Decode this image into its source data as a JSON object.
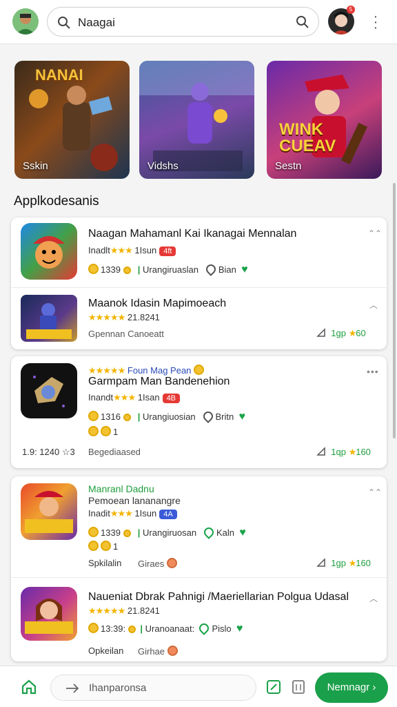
{
  "header": {
    "search_value": "Naagai",
    "notification_count": "5"
  },
  "banners": [
    {
      "title": "NANAI",
      "label": "Sskin"
    },
    {
      "title": "",
      "label": "Vidshs"
    },
    {
      "title": "WINK CUEAV",
      "label": "Sestn"
    }
  ],
  "section_title": "Applkodesanis",
  "cards": [
    {
      "items": [
        {
          "title": "Naagan Mahamanl Kai Ikanagai Mennalan",
          "dev": "Inadlt",
          "stars": "★★★",
          "rating": "1Isun",
          "tag": "4ft",
          "coins": "1339",
          "status": "Urangiruaslan",
          "loc": "Bian"
        },
        {
          "title": "Maanok Idasin Mapimoeach",
          "stars": "★★★★★",
          "rating": "21.8241",
          "meta": "Gpennan Canoeatt",
          "share": "1gp",
          "share_score": "60"
        }
      ]
    },
    {
      "items": [
        {
          "headline": "Foun Mag Pean",
          "stars": "★★★★★",
          "title": "Garmpam Man Bandenehion",
          "dev": "Inandt",
          "stars2": "★★★",
          "rating": "1Isan",
          "tag": "4B",
          "coins": "1316",
          "status": "Urangiuosian",
          "loc": "Britn",
          "extra": "1",
          "footer_left": "1.9: 1240 ☆3",
          "footer_mid": "Begediaased",
          "share": "1qp",
          "share_score": "160"
        }
      ]
    },
    {
      "items": [
        {
          "headline": "Manranl Dadnu",
          "sub": "Pemoean lananangre",
          "dev": "Inadit",
          "stars": "★★★",
          "rating": "1Isun",
          "tag": "4A",
          "coins": "1339",
          "status": "Urangiruosan",
          "loc": "Kaln",
          "extra": "1",
          "footer_left": "Spkilalin",
          "footer_mid": "Giraes",
          "share": "1gp",
          "share_score": "160"
        },
        {
          "title": "Naueniat Dbrak Pahnigi /Maeriellarian Polgua Udasal",
          "stars": "★★★★★",
          "rating": "21.8241",
          "coins": "13:39:",
          "status": "Uranoanaat:",
          "loc": "Pislo",
          "footer_left": "Opkeilan",
          "footer_mid": "Girhae"
        }
      ]
    }
  ],
  "bottom": {
    "input_placeholder": "Ihanparonsa",
    "cta": "Nemnagr ›"
  },
  "colors": {
    "accent": "#1aa04a",
    "star": "#f4b400"
  }
}
